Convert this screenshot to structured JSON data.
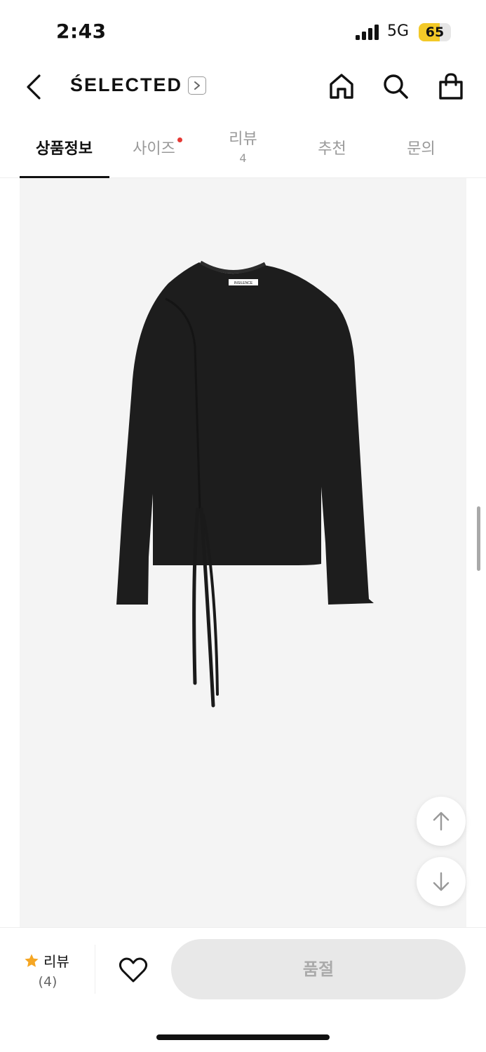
{
  "status_bar": {
    "time": "2:43",
    "network": "5G",
    "battery_level": "65",
    "battery_fraction": 0.65,
    "battery_color": "#f3c928"
  },
  "header": {
    "back_icon": "chevron-left-icon",
    "brand": "ŚELECTED",
    "brand_arrow_icon": "chevron-right-icon",
    "home_icon": "home-icon",
    "search_icon": "search-icon",
    "cart_icon": "shopping-bag-icon"
  },
  "tabs": [
    {
      "label": "상품정보",
      "active": true
    },
    {
      "label": "사이즈",
      "has_dot": true,
      "dot_color": "#e53935"
    },
    {
      "label": "리뷰",
      "count": "4"
    },
    {
      "label": "추천"
    },
    {
      "label": "문의"
    }
  ],
  "product": {
    "image": "black long-sleeve t-shirt with drawstring ties",
    "tag_text": "INSILENCE"
  },
  "floating": {
    "up_icon": "arrow-up-icon",
    "down_icon": "arrow-down-icon"
  },
  "bottom_bar": {
    "star_icon": "star-icon",
    "star_color": "#f5a623",
    "review_label": "리뷰",
    "review_count": "(4)",
    "heart_icon": "heart-icon",
    "soldout_label": "품절"
  }
}
